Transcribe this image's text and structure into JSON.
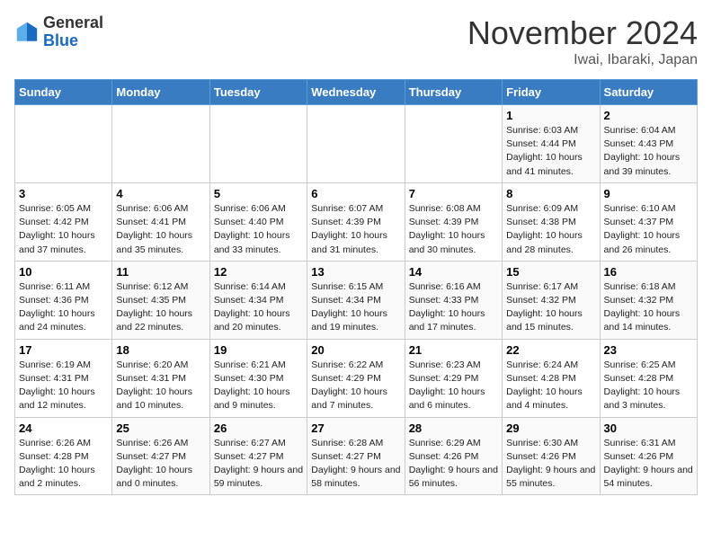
{
  "header": {
    "logo_line1": "General",
    "logo_line2": "Blue",
    "month": "November 2024",
    "location": "Iwai, Ibaraki, Japan"
  },
  "weekdays": [
    "Sunday",
    "Monday",
    "Tuesday",
    "Wednesday",
    "Thursday",
    "Friday",
    "Saturday"
  ],
  "weeks": [
    [
      {
        "day": "",
        "info": ""
      },
      {
        "day": "",
        "info": ""
      },
      {
        "day": "",
        "info": ""
      },
      {
        "day": "",
        "info": ""
      },
      {
        "day": "",
        "info": ""
      },
      {
        "day": "1",
        "info": "Sunrise: 6:03 AM\nSunset: 4:44 PM\nDaylight: 10 hours and 41 minutes."
      },
      {
        "day": "2",
        "info": "Sunrise: 6:04 AM\nSunset: 4:43 PM\nDaylight: 10 hours and 39 minutes."
      }
    ],
    [
      {
        "day": "3",
        "info": "Sunrise: 6:05 AM\nSunset: 4:42 PM\nDaylight: 10 hours and 37 minutes."
      },
      {
        "day": "4",
        "info": "Sunrise: 6:06 AM\nSunset: 4:41 PM\nDaylight: 10 hours and 35 minutes."
      },
      {
        "day": "5",
        "info": "Sunrise: 6:06 AM\nSunset: 4:40 PM\nDaylight: 10 hours and 33 minutes."
      },
      {
        "day": "6",
        "info": "Sunrise: 6:07 AM\nSunset: 4:39 PM\nDaylight: 10 hours and 31 minutes."
      },
      {
        "day": "7",
        "info": "Sunrise: 6:08 AM\nSunset: 4:39 PM\nDaylight: 10 hours and 30 minutes."
      },
      {
        "day": "8",
        "info": "Sunrise: 6:09 AM\nSunset: 4:38 PM\nDaylight: 10 hours and 28 minutes."
      },
      {
        "day": "9",
        "info": "Sunrise: 6:10 AM\nSunset: 4:37 PM\nDaylight: 10 hours and 26 minutes."
      }
    ],
    [
      {
        "day": "10",
        "info": "Sunrise: 6:11 AM\nSunset: 4:36 PM\nDaylight: 10 hours and 24 minutes."
      },
      {
        "day": "11",
        "info": "Sunrise: 6:12 AM\nSunset: 4:35 PM\nDaylight: 10 hours and 22 minutes."
      },
      {
        "day": "12",
        "info": "Sunrise: 6:14 AM\nSunset: 4:34 PM\nDaylight: 10 hours and 20 minutes."
      },
      {
        "day": "13",
        "info": "Sunrise: 6:15 AM\nSunset: 4:34 PM\nDaylight: 10 hours and 19 minutes."
      },
      {
        "day": "14",
        "info": "Sunrise: 6:16 AM\nSunset: 4:33 PM\nDaylight: 10 hours and 17 minutes."
      },
      {
        "day": "15",
        "info": "Sunrise: 6:17 AM\nSunset: 4:32 PM\nDaylight: 10 hours and 15 minutes."
      },
      {
        "day": "16",
        "info": "Sunrise: 6:18 AM\nSunset: 4:32 PM\nDaylight: 10 hours and 14 minutes."
      }
    ],
    [
      {
        "day": "17",
        "info": "Sunrise: 6:19 AM\nSunset: 4:31 PM\nDaylight: 10 hours and 12 minutes."
      },
      {
        "day": "18",
        "info": "Sunrise: 6:20 AM\nSunset: 4:31 PM\nDaylight: 10 hours and 10 minutes."
      },
      {
        "day": "19",
        "info": "Sunrise: 6:21 AM\nSunset: 4:30 PM\nDaylight: 10 hours and 9 minutes."
      },
      {
        "day": "20",
        "info": "Sunrise: 6:22 AM\nSunset: 4:29 PM\nDaylight: 10 hours and 7 minutes."
      },
      {
        "day": "21",
        "info": "Sunrise: 6:23 AM\nSunset: 4:29 PM\nDaylight: 10 hours and 6 minutes."
      },
      {
        "day": "22",
        "info": "Sunrise: 6:24 AM\nSunset: 4:28 PM\nDaylight: 10 hours and 4 minutes."
      },
      {
        "day": "23",
        "info": "Sunrise: 6:25 AM\nSunset: 4:28 PM\nDaylight: 10 hours and 3 minutes."
      }
    ],
    [
      {
        "day": "24",
        "info": "Sunrise: 6:26 AM\nSunset: 4:28 PM\nDaylight: 10 hours and 2 minutes."
      },
      {
        "day": "25",
        "info": "Sunrise: 6:26 AM\nSunset: 4:27 PM\nDaylight: 10 hours and 0 minutes."
      },
      {
        "day": "26",
        "info": "Sunrise: 6:27 AM\nSunset: 4:27 PM\nDaylight: 9 hours and 59 minutes."
      },
      {
        "day": "27",
        "info": "Sunrise: 6:28 AM\nSunset: 4:27 PM\nDaylight: 9 hours and 58 minutes."
      },
      {
        "day": "28",
        "info": "Sunrise: 6:29 AM\nSunset: 4:26 PM\nDaylight: 9 hours and 56 minutes."
      },
      {
        "day": "29",
        "info": "Sunrise: 6:30 AM\nSunset: 4:26 PM\nDaylight: 9 hours and 55 minutes."
      },
      {
        "day": "30",
        "info": "Sunrise: 6:31 AM\nSunset: 4:26 PM\nDaylight: 9 hours and 54 minutes."
      }
    ]
  ]
}
